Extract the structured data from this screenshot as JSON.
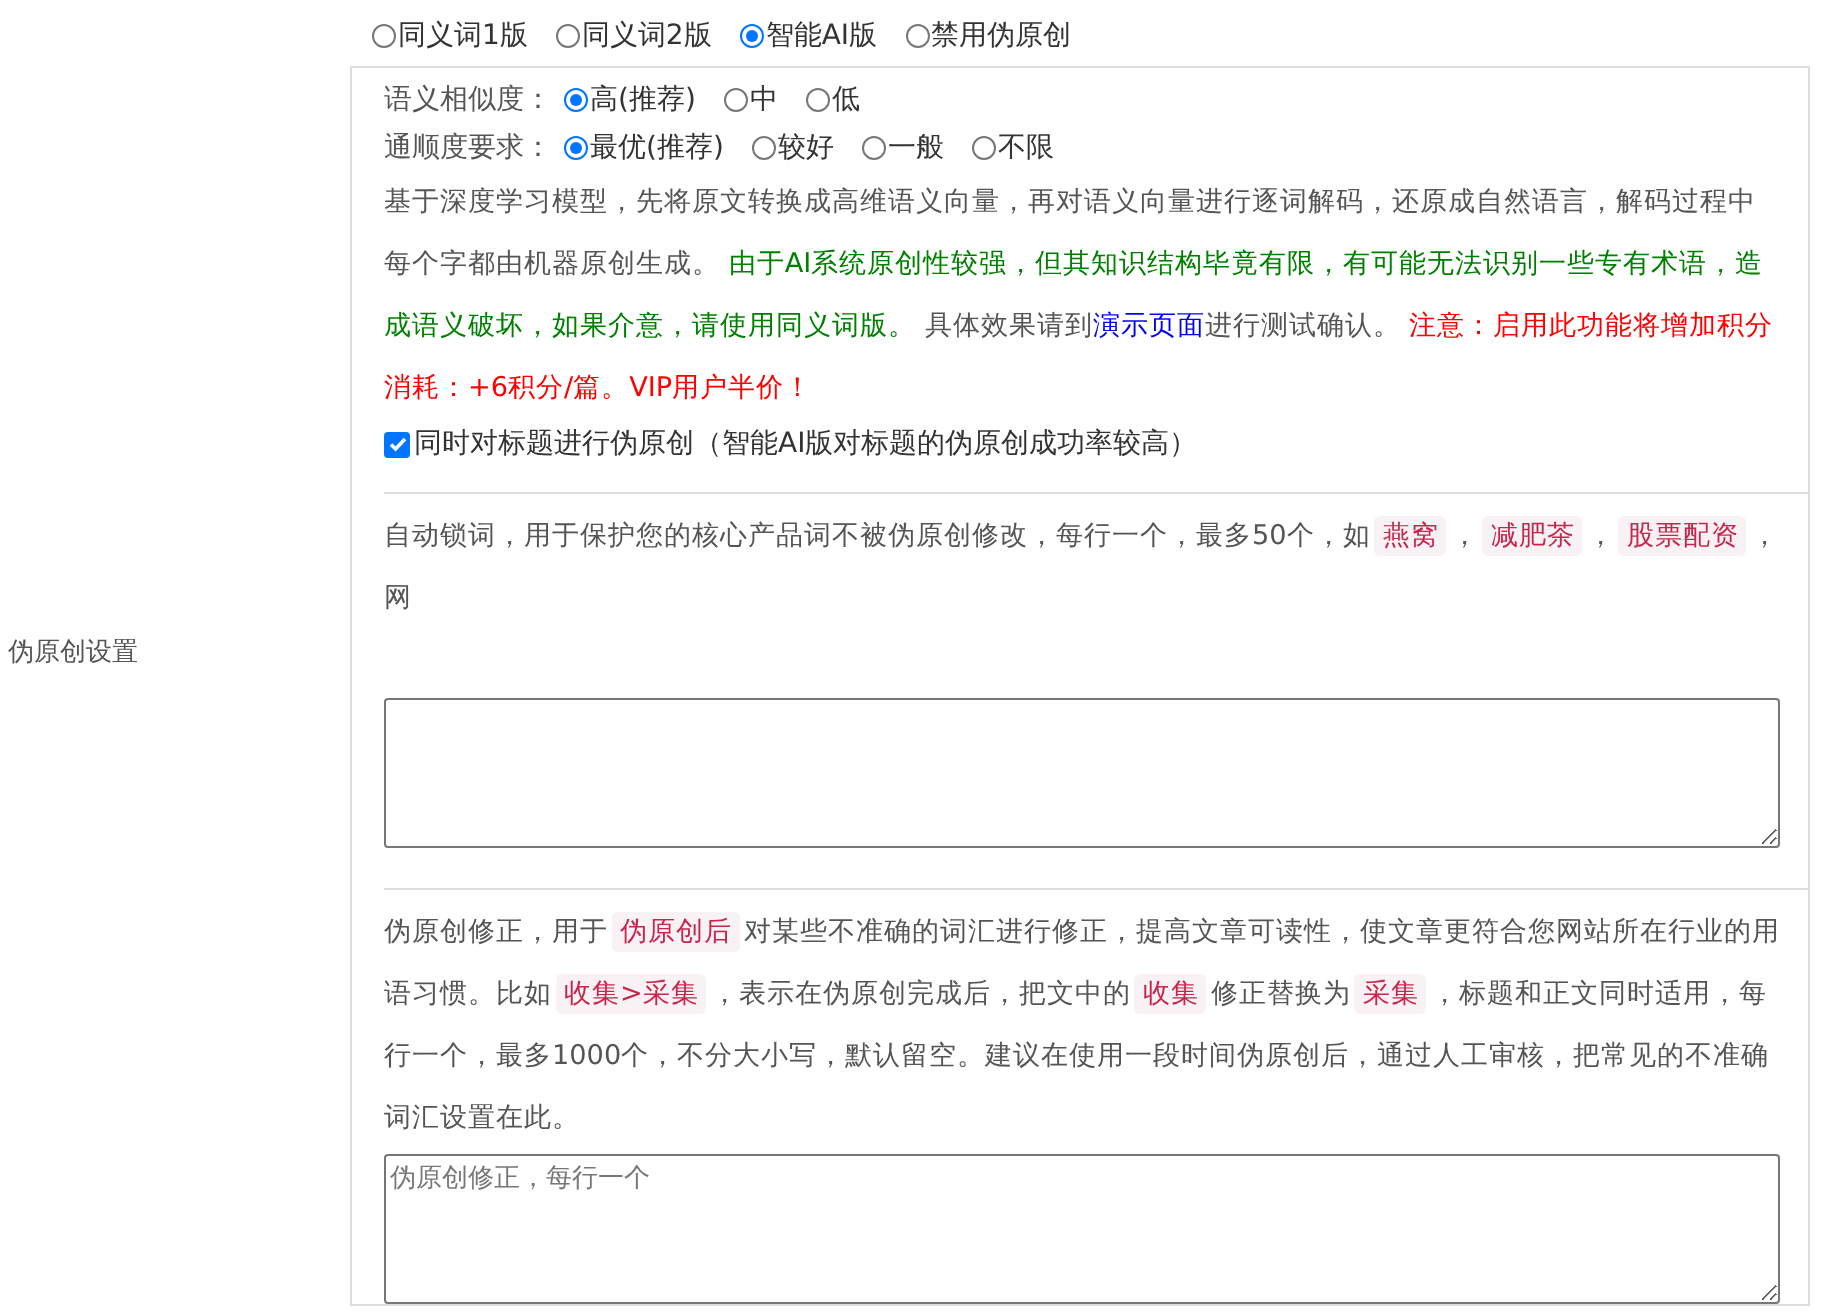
{
  "sidebar_label": "伪原创设置",
  "mode_options": [
    {
      "label": "同义词1版",
      "selected": false
    },
    {
      "label": "同义词2版",
      "selected": false
    },
    {
      "label": "智能AI版",
      "selected": true
    },
    {
      "label": "禁用伪原创",
      "selected": false
    }
  ],
  "similarity": {
    "label": "语义相似度：",
    "options": [
      {
        "label": "高(推荐)",
        "selected": true
      },
      {
        "label": "中",
        "selected": false
      },
      {
        "label": "低",
        "selected": false
      }
    ]
  },
  "fluency": {
    "label": "通顺度要求：",
    "options": [
      {
        "label": "最优(推荐)",
        "selected": true
      },
      {
        "label": "较好",
        "selected": false
      },
      {
        "label": "一般",
        "selected": false
      },
      {
        "label": "不限",
        "selected": false
      }
    ]
  },
  "ai_description": [
    {
      "kind": "text",
      "text": "基于深度学习模型，先将原文转换成高维语义向量，再对语义向量进行逐词解码，还原成自然语言，解码过程中每个字都由机器原创生成。 "
    },
    {
      "kind": "note",
      "text": "由于AI系统原创性较强，但其知识结构毕竟有限，有可能无法识别一些专有术语，造成语义破坏，如果介意，请使用同义词版。"
    },
    {
      "kind": "text",
      "text": " 具体效果请到"
    },
    {
      "kind": "link",
      "text": "演示页面"
    },
    {
      "kind": "text",
      "text": "进行测试确认。 "
    },
    {
      "kind": "warning",
      "text": "注意：启用此功能将增加积分消耗：+6积分/篇。VIP用户半价！"
    }
  ],
  "title_checkbox": {
    "label": "同时对标题进行伪原创（智能AI版对标题的伪原创成功率较高）",
    "checked": true
  },
  "lock_words": {
    "description": [
      {
        "kind": "text",
        "text": "自动锁词，用于保护您的核心产品词不被伪原创修改，每行一个，最多50个，如"
      },
      {
        "kind": "tag",
        "text": "燕窝"
      },
      {
        "kind": "text",
        "text": "，"
      },
      {
        "kind": "tag",
        "text": "减肥茶"
      },
      {
        "kind": "text",
        "text": "，"
      },
      {
        "kind": "tag",
        "text": "股票配资"
      },
      {
        "kind": "text",
        "text": "，网"
      }
    ]
  },
  "correction": {
    "description": [
      {
        "kind": "text",
        "text": "伪原创修正，用于"
      },
      {
        "kind": "tag",
        "text": "伪原创后"
      },
      {
        "kind": "text",
        "text": "对某些不准确的词汇进行修正，提高文章可读性，使文章更符合您网站所在行业的用语习惯。比如"
      },
      {
        "kind": "tag",
        "text": "收集>采集"
      },
      {
        "kind": "text",
        "text": "，表示在伪原创完成后，把文中的"
      },
      {
        "kind": "tag",
        "text": "收集"
      },
      {
        "kind": "text",
        "text": "修正替换为"
      },
      {
        "kind": "tag",
        "text": "采集"
      },
      {
        "kind": "text",
        "text": "，标题和正文同时适用，每行一个，最多1000个，不分大小写，默认留空。建议在使用一段时间伪原创后，通过人工审核，把常见的不准确词汇设置在此。"
      }
    ],
    "placeholder": "伪原创修正，每行一个"
  }
}
